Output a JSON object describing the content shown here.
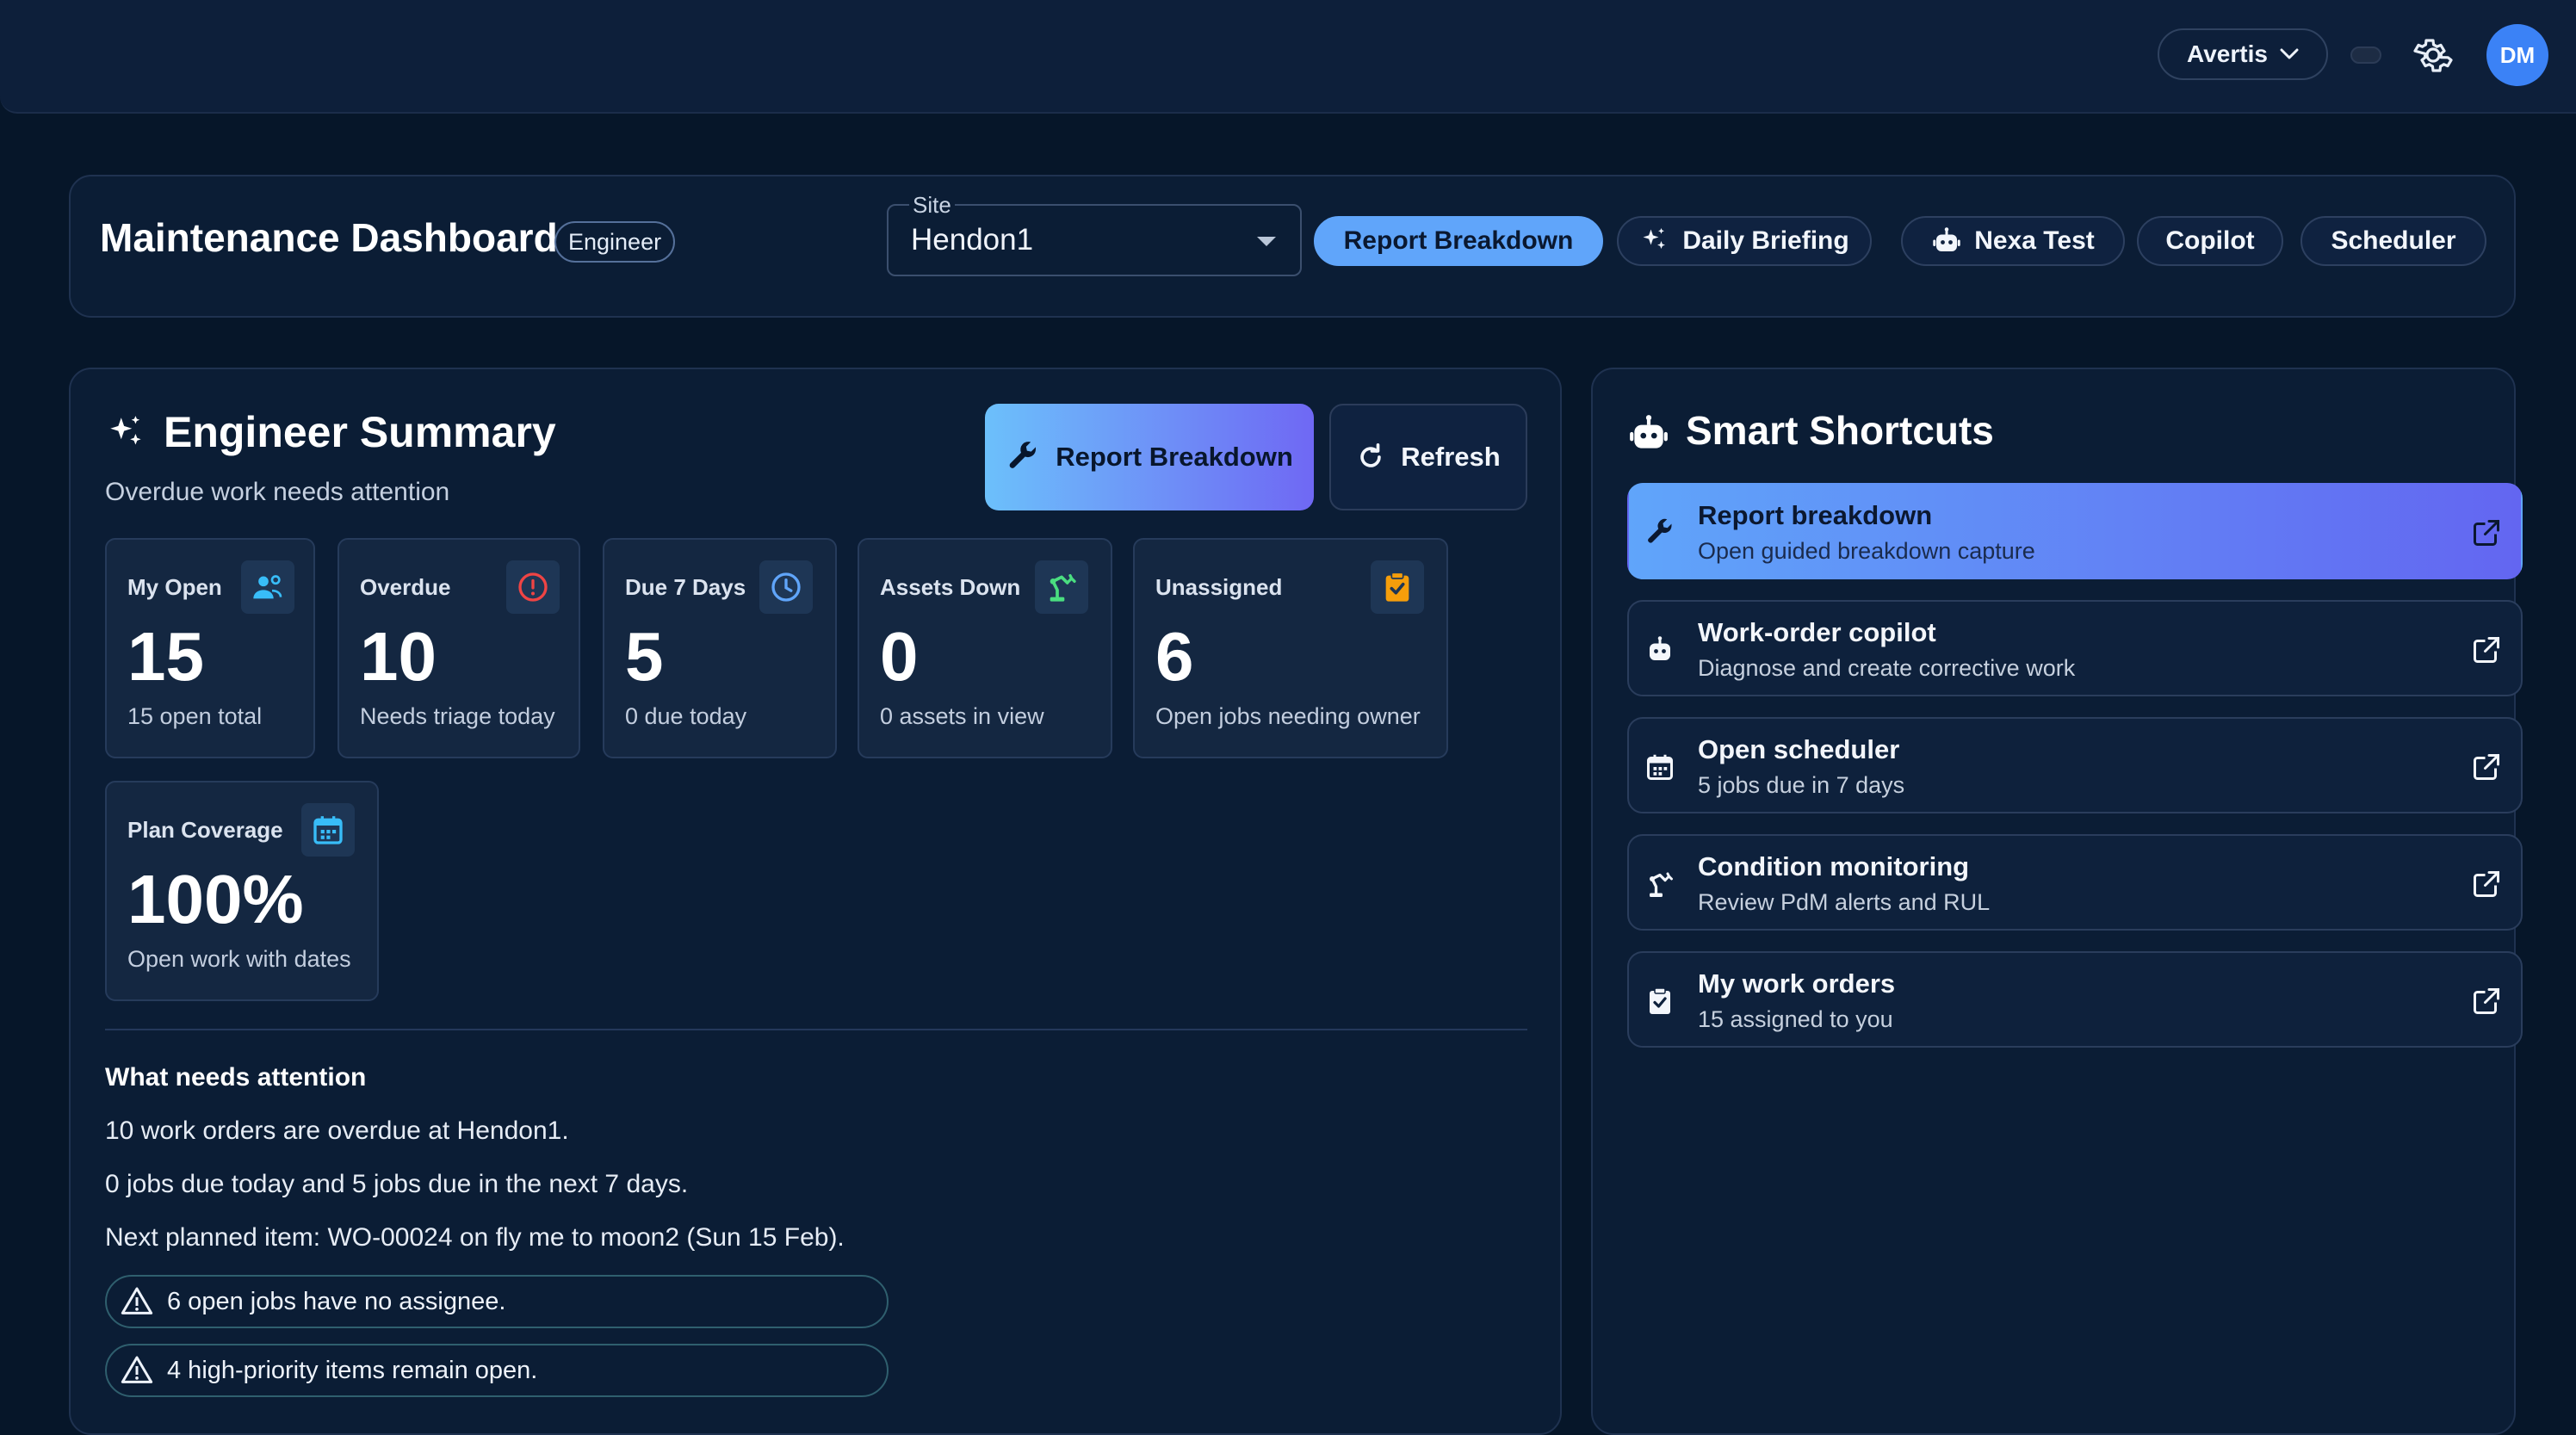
{
  "topbar": {
    "account": "Avertis",
    "avatar_initials": "DM"
  },
  "header": {
    "title": "Maintenance Dashboard",
    "role_badge": "Engineer",
    "site_label": "Site",
    "site_value": "Hendon1",
    "buttons": {
      "report_breakdown": "Report Breakdown",
      "daily_briefing": "Daily Briefing",
      "nexa_test": "Nexa Test",
      "copilot": "Copilot",
      "scheduler": "Scheduler"
    }
  },
  "summary": {
    "title": "Engineer Summary",
    "subtitle": "Overdue work needs attention",
    "report_button": "Report Breakdown",
    "refresh_button": "Refresh",
    "kpis": [
      {
        "label": "My Open",
        "value": "15",
        "caption": "15 open total",
        "icon": "users-icon",
        "color": "#38bdf8"
      },
      {
        "label": "Overdue",
        "value": "10",
        "caption": "Needs triage today",
        "icon": "alert-circle-icon",
        "color": "#ef4444"
      },
      {
        "label": "Due 7 Days",
        "value": "5",
        "caption": "0 due today",
        "icon": "clock-icon",
        "color": "#60a5fa"
      },
      {
        "label": "Assets Down",
        "value": "0",
        "caption": "0 assets in view",
        "icon": "robot-arm-icon",
        "color": "#4ade80"
      },
      {
        "label": "Unassigned",
        "value": "6",
        "caption": "Open jobs needing owner",
        "icon": "clipboard-check-icon",
        "color": "#f59e0b"
      },
      {
        "label": "Plan Coverage",
        "value": "100%",
        "caption": "Open work with dates",
        "icon": "calendar-icon",
        "color": "#38bdf8"
      }
    ],
    "attention": {
      "title": "What needs attention",
      "lines": [
        "10 work orders are overdue at Hendon1.",
        "0 jobs due today and 5 jobs due in the next 7 days.",
        "Next planned item: WO-00024 on fly me to moon2 (Sun 15 Feb)."
      ],
      "warnings": [
        "6 open jobs have no assignee.",
        "4 high-priority items remain open."
      ]
    }
  },
  "shortcuts": {
    "title": "Smart Shortcuts",
    "items": [
      {
        "title": "Report breakdown",
        "desc": "Open guided breakdown capture",
        "icon": "wrench-icon"
      },
      {
        "title": "Work-order copilot",
        "desc": "Diagnose and create corrective work",
        "icon": "robot-icon"
      },
      {
        "title": "Open scheduler",
        "desc": "5 jobs due in 7 days",
        "icon": "calendar-icon"
      },
      {
        "title": "Condition monitoring",
        "desc": "Review PdM alerts and RUL",
        "icon": "robot-arm-icon"
      },
      {
        "title": "My work orders",
        "desc": "15 assigned to you",
        "icon": "clipboard-check-icon"
      }
    ]
  }
}
